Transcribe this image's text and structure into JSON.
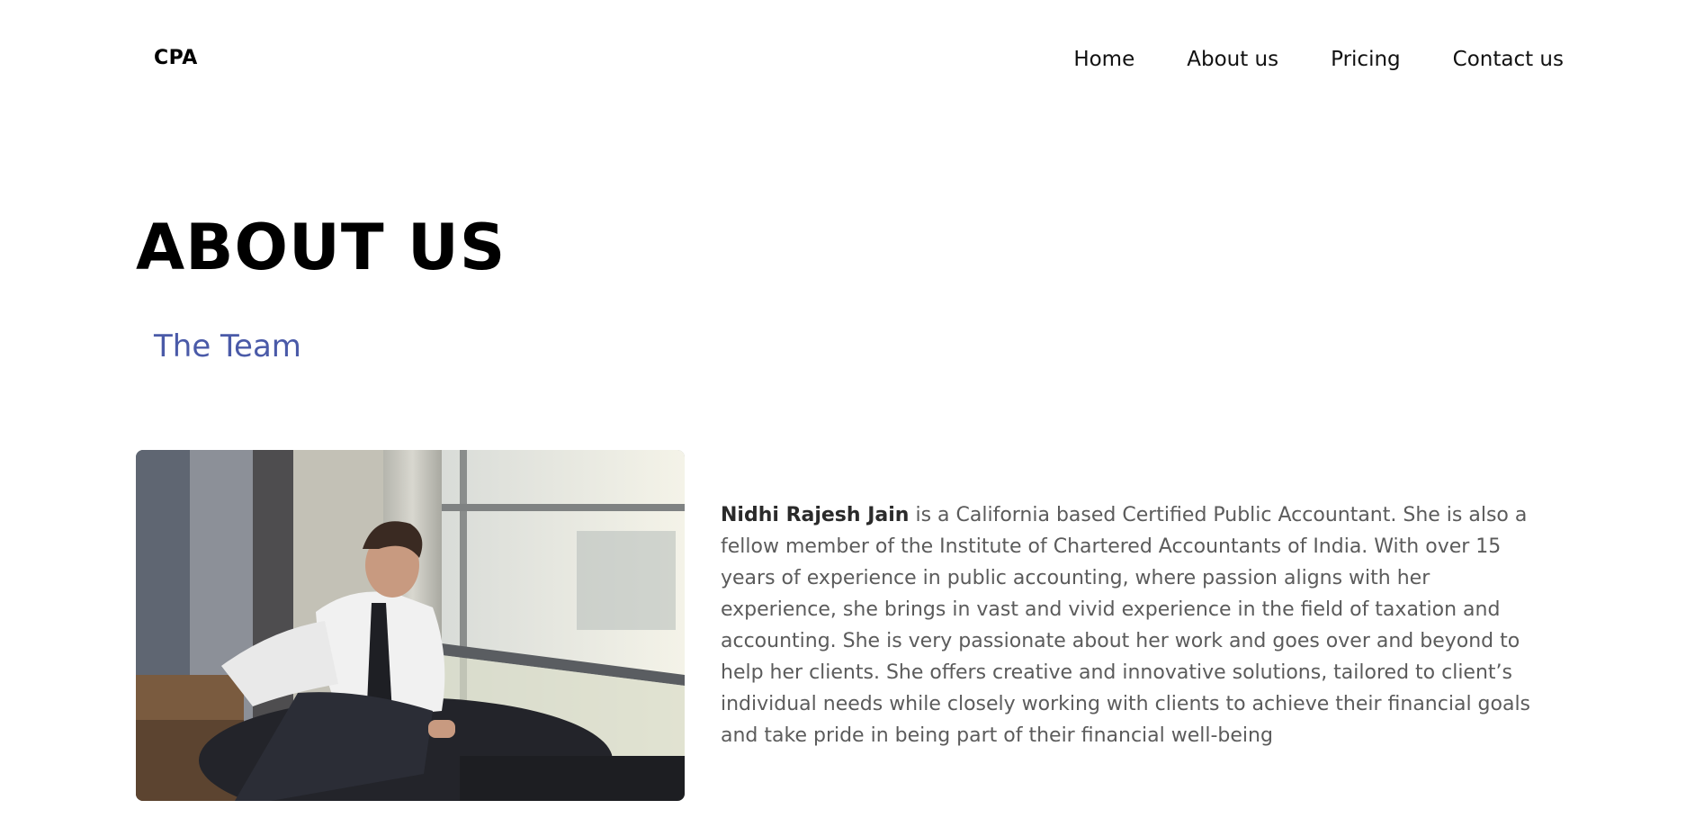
{
  "header": {
    "logo": "CPA",
    "nav": [
      {
        "label": "Home"
      },
      {
        "label": "About us"
      },
      {
        "label": "Pricing"
      },
      {
        "label": "Contact us"
      }
    ]
  },
  "main": {
    "title": "ABOUT US",
    "section_title": "The Team",
    "team_member": {
      "name": "Nidhi Rajesh Jain",
      "bio": " is a California based Certified Public Accountant. She is also a fellow member of the Institute of Chartered Accountants of India. With over 15 years of experience in public accounting, where passion aligns with her experience, she brings in vast and vivid experience in the field of taxation and accounting. She is very passionate about her work and goes over and beyond to help her clients. She offers creative and innovative solutions, tailored to client’s individual needs while closely working with clients to achieve their financial goals and take pride in being part of their financial well-being"
    }
  },
  "colors": {
    "accent": "#4a5aa8",
    "body_text": "#5b5b5b",
    "heading": "#000000"
  }
}
